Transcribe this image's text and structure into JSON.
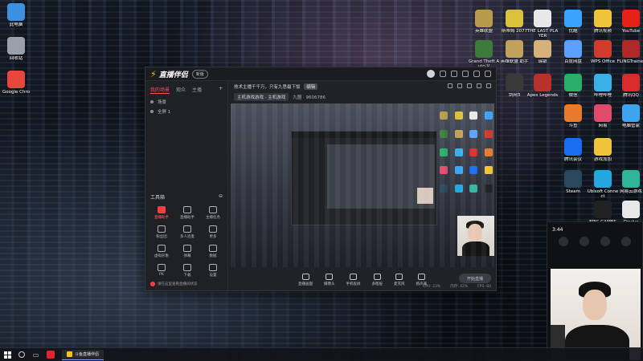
{
  "desktop": {
    "left_icons": [
      {
        "label": "此电脑",
        "icon": "computer-icon",
        "color": "#3d8fe0"
      },
      {
        "label": "回收站",
        "icon": "recycle-bin-icon",
        "color": "#9aa0a9"
      },
      {
        "label": "Google Chro",
        "icon": "chrome-icon",
        "color": "#e8453c"
      }
    ],
    "top_icons": [
      {
        "label": "英雄联盟",
        "icon": "league-icon",
        "color": "#b79a4b"
      },
      {
        "label": "斯蒂姆 2077",
        "icon": "game-icon",
        "color": "#d9c23a"
      },
      {
        "label": "THE LAST PLAYER",
        "icon": "document-icon",
        "color": "#e8e8e8"
      },
      {
        "label": "优酷",
        "icon": "video-icon",
        "color": "#3aa3ff"
      },
      {
        "label": "腾讯视频",
        "icon": "folder-icon",
        "color": "#f0c43a"
      },
      {
        "label": "YouTube",
        "icon": "youtube-icon",
        "color": "#e62117"
      }
    ],
    "right_icons": [
      {
        "label": "Grand Theft Auto V",
        "icon": "gta-icon",
        "color": "#3c7a3c"
      },
      {
        "label": "英雄联盟 助手",
        "icon": "game-icon",
        "color": "#c2a15a"
      },
      {
        "label": "瑞银",
        "icon": "app-icon",
        "color": "#d4b27a"
      },
      {
        "label": "百度网盘",
        "icon": "cloud-icon",
        "color": "#5aa0ff"
      },
      {
        "label": "WPS Office",
        "icon": "wps-icon",
        "color": "#d23a2c"
      },
      {
        "label": "FLiNGTrainer",
        "icon": "trainer-icon",
        "color": "#b02828"
      },
      {
        "label": "剑网3",
        "icon": "game-icon",
        "color": "#3a3a3a"
      },
      {
        "label": "Apex Legends",
        "icon": "apex-icon",
        "color": "#b7322c"
      },
      {
        "label": "微信",
        "icon": "wechat-icon",
        "color": "#2aae67"
      },
      {
        "label": "哔哩哔哩",
        "icon": "bilibili-icon",
        "color": "#3ab1e6"
      },
      {
        "label": "腾讯QQ",
        "icon": "qq-icon",
        "color": "#d82c2c"
      },
      {
        "label": "斗鱼",
        "icon": "app-icon",
        "color": "#e87a2b"
      },
      {
        "label": "网易",
        "icon": "app-icon",
        "color": "#e24a6b"
      },
      {
        "label": "电脑管家",
        "icon": "shield-icon",
        "color": "#3da5f0"
      },
      {
        "label": "腾讯会议",
        "icon": "meeting-icon",
        "color": "#1a6cf0"
      },
      {
        "label": "游戏加加",
        "icon": "app-icon",
        "color": "#f0c43a"
      },
      {
        "label": "Steam",
        "icon": "steam-icon",
        "color": "#2a475e"
      },
      {
        "label": "Ubisoft Connect",
        "icon": "ubisoft-icon",
        "color": "#24a6e0"
      },
      {
        "label": "网易云游戏",
        "icon": "game-icon",
        "color": "#2fb59a"
      },
      {
        "label": "EPIC GAMES",
        "icon": "epic-icon",
        "color": "#222222"
      },
      {
        "label": "Oculus",
        "icon": "oculus-icon",
        "color": "#e8e8e8"
      }
    ]
  },
  "app": {
    "name": "直播伴侣",
    "pill": "新版",
    "tabs": [
      "我的场景",
      "观众",
      "主播"
    ],
    "scenes": [
      "场景",
      "全屏 1"
    ],
    "tools_title": "工具箱",
    "tools": [
      {
        "label": "直播助手",
        "icon": "assistant-icon",
        "highlight": true
      },
      {
        "label": "直播助手",
        "icon": "mic-icon",
        "highlight": false
      },
      {
        "label": "主播任务",
        "icon": "task-icon",
        "highlight": false
      },
      {
        "label": "粉丝团",
        "icon": "fans-icon",
        "highlight": false
      },
      {
        "label": "多人连麦",
        "icon": "download-icon",
        "highlight": false
      },
      {
        "label": "更多",
        "icon": "grid-icon",
        "highlight": false
      },
      {
        "label": "虚拟形象",
        "icon": "avatar-icon",
        "highlight": false
      },
      {
        "label": "弹幕",
        "icon": "chat-icon",
        "highlight": false
      },
      {
        "label": "数据",
        "icon": "chart-icon",
        "highlight": false
      },
      {
        "label": "PK",
        "icon": "pk-icon",
        "highlight": false
      },
      {
        "label": "下载",
        "icon": "download-icon",
        "highlight": false
      },
      {
        "label": "设置",
        "icon": "settings-icon",
        "highlight": false
      }
    ],
    "bottom_note": "请在这里查看直播间状态",
    "banner_line1": "技术主播千千万，只有九思最下饭",
    "banner_badge": "编辑",
    "banner_chip1": "主机游戏游戏 · 主机游戏",
    "banner_count": "九盟 · 9606786",
    "controls": [
      "直播画面",
      "摄像头",
      "手机投屏",
      "多图层",
      "麦克风",
      "扬声器"
    ],
    "start_button": "开始直播",
    "status": [
      "CPU: 23%",
      "内存: 42%",
      "FPS: 60"
    ]
  },
  "phone": {
    "time": "3:44"
  },
  "taskbar": {
    "window_title": "斗鱼直播伴侣"
  }
}
